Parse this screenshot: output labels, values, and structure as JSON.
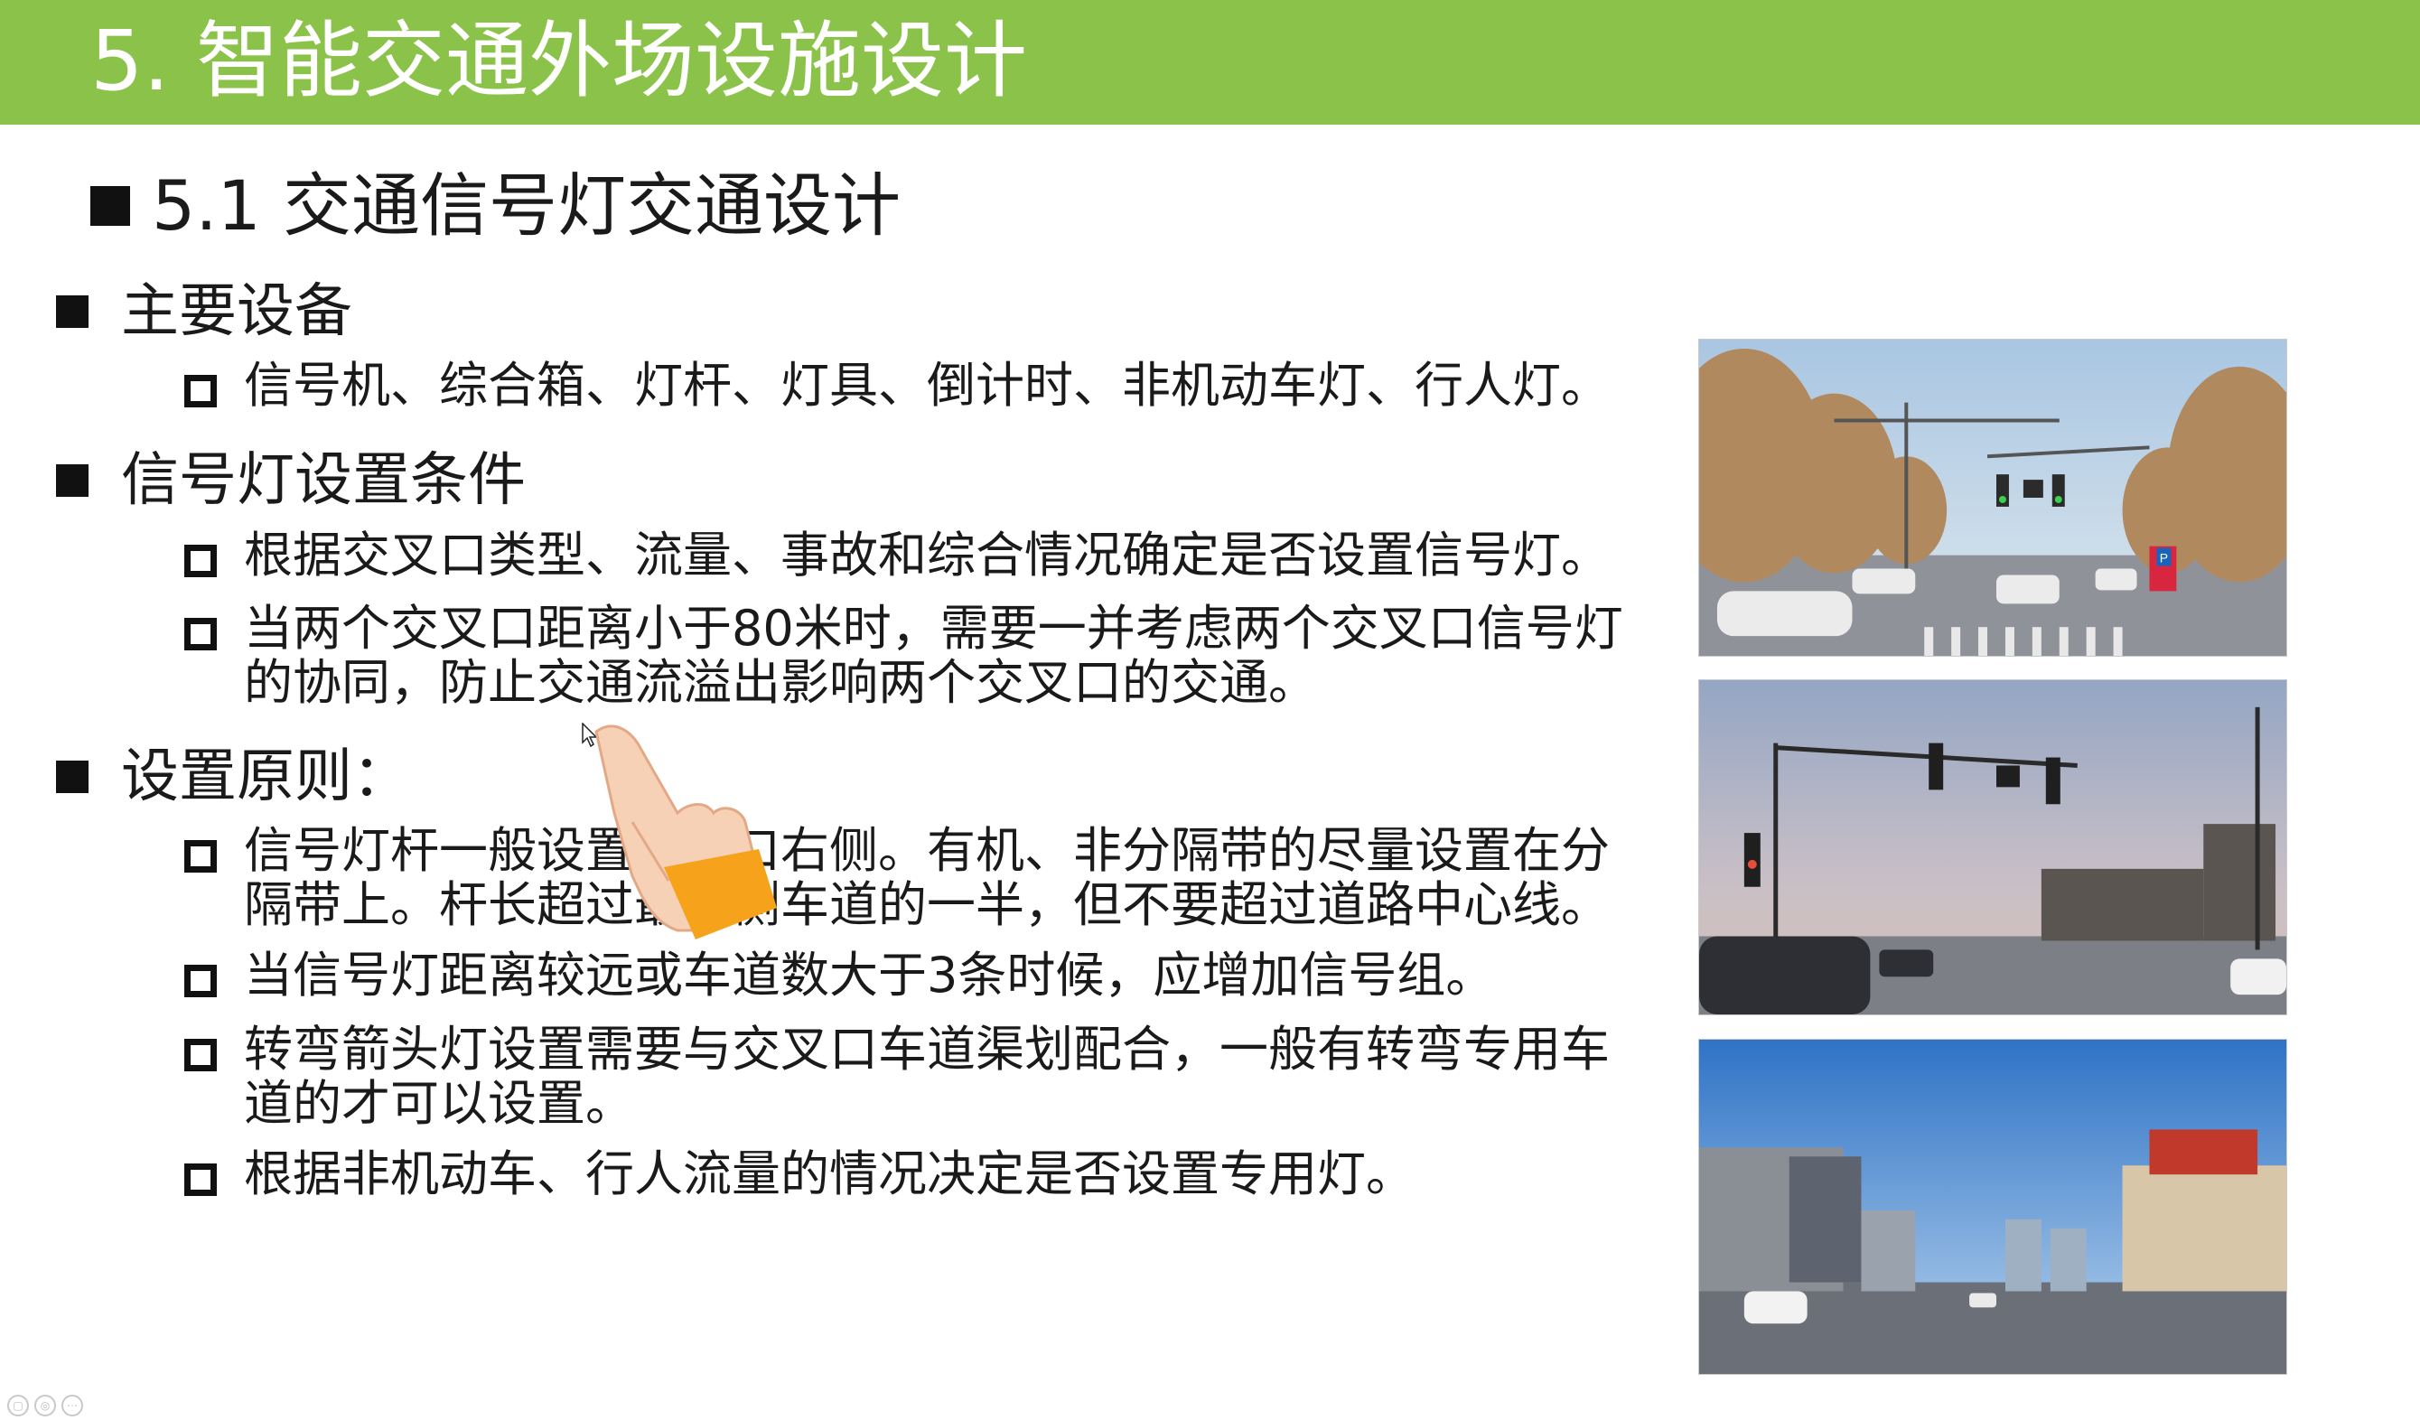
{
  "slide": {
    "title": "5. 智能交通外场设施设计",
    "section": "5.1 交通信号灯交通设计"
  },
  "bullets": [
    {
      "label": "主要设备",
      "items": [
        "信号机、综合箱、灯杆、灯具、倒计时、非机动车灯、行人灯。"
      ]
    },
    {
      "label": "信号灯设置条件",
      "items": [
        "根据交叉口类型、流量、事故和综合情况确定是否设置信号灯。",
        "当两个交叉口距离小于80米时，需要一并考虑两个交叉口信号灯\n的协同，防止交通流溢出影响两个交叉口的交通。"
      ]
    },
    {
      "label": "设置原则：",
      "items": [
        "信号灯杆一般设置在路口右侧。有机、非分隔带的尽量设置在分\n隔带上。杆长超过最外侧车道的一半，但不要超过道路中心线。",
        "当信号灯距离较远或车道数大于3条时候，应增加信号组。",
        "转弯箭头灯设置需要与交叉口车道渠划配合，一般有转弯专用车\n道的才可以设置。",
        "根据非机动车、行人流量的情况决定是否设置专用灯。"
      ]
    }
  ],
  "photos": [
    {
      "name": "intersection-photo-autumn-trees",
      "sign_text": "P"
    },
    {
      "name": "intersection-photo-dusk-signal-gantry"
    },
    {
      "name": "intersection-photo-wide-avenue-buildings"
    }
  ],
  "icons": [
    "hand-pointer-icon",
    "mouse-cursor-icon",
    "presenter-tool-icon"
  ],
  "colors": {
    "title_bar": "#8bc34a",
    "title_text": "#ffffff",
    "body_text": "#1a1a1a"
  }
}
